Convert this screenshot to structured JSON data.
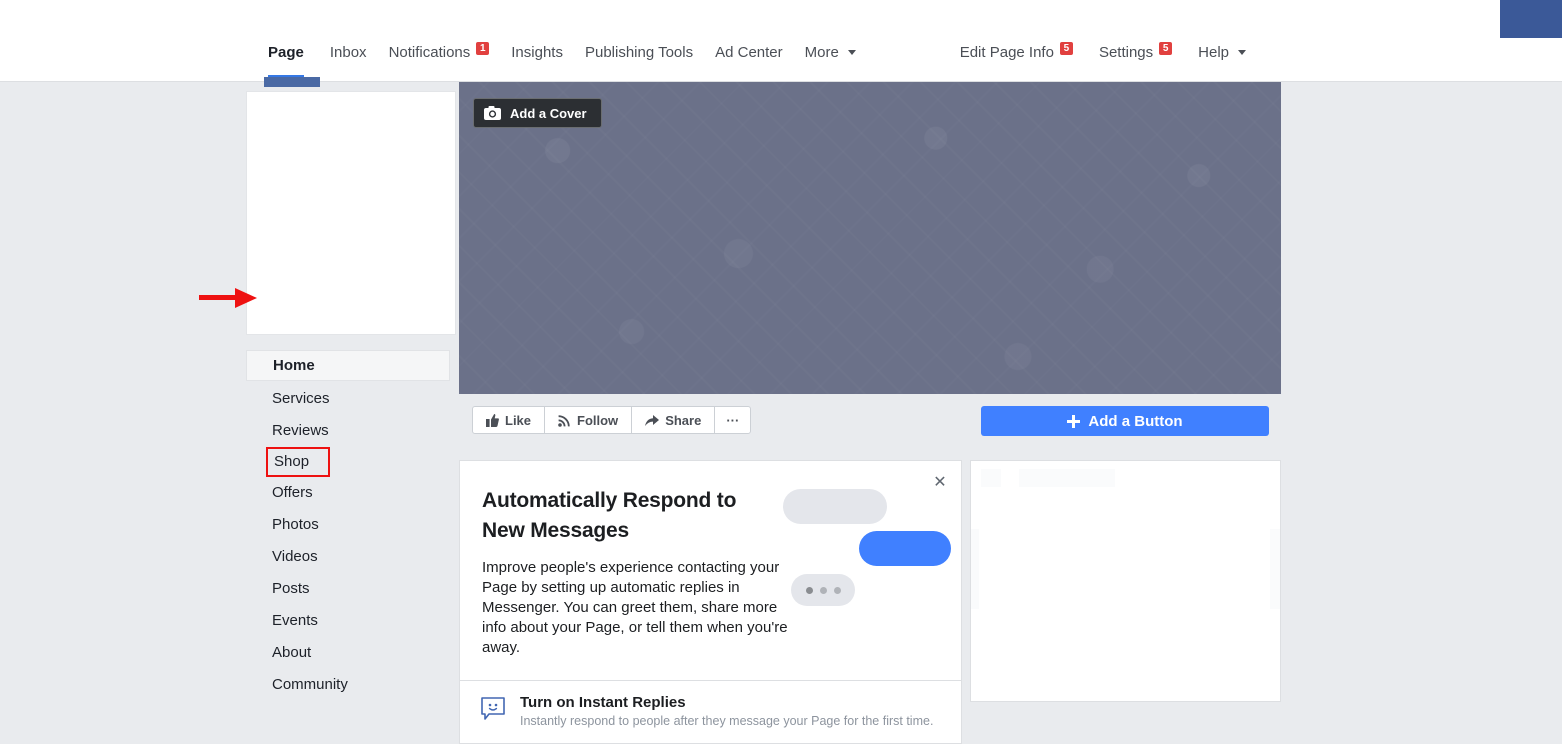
{
  "topbar": {
    "nav_left": [
      {
        "label": "Page",
        "active": true,
        "badge": null,
        "caret": false
      },
      {
        "label": "Inbox",
        "active": false,
        "badge": null,
        "caret": false
      },
      {
        "label": "Notifications",
        "active": false,
        "badge": "1",
        "caret": false
      },
      {
        "label": "Insights",
        "active": false,
        "badge": null,
        "caret": false
      },
      {
        "label": "Publishing Tools",
        "active": false,
        "badge": null,
        "caret": false
      },
      {
        "label": "Ad Center",
        "active": false,
        "badge": null,
        "caret": false
      },
      {
        "label": "More",
        "active": false,
        "badge": null,
        "caret": true
      }
    ],
    "nav_right": [
      {
        "label": "Edit Page Info",
        "badge": "5",
        "caret": false
      },
      {
        "label": "Settings",
        "badge": "5",
        "caret": false
      },
      {
        "label": "Help",
        "badge": null,
        "caret": true
      }
    ]
  },
  "cover": {
    "add_cover_label": "Add a Cover",
    "camera_icon": "camera-icon",
    "bg_color": "#6b7189"
  },
  "sidebar": {
    "items": [
      {
        "label": "Home",
        "state": "current"
      },
      {
        "label": "Services",
        "state": "normal"
      },
      {
        "label": "Reviews",
        "state": "normal"
      },
      {
        "label": "Shop",
        "state": "marked"
      },
      {
        "label": "Offers",
        "state": "normal"
      },
      {
        "label": "Photos",
        "state": "normal"
      },
      {
        "label": "Videos",
        "state": "normal"
      },
      {
        "label": "Posts",
        "state": "normal"
      },
      {
        "label": "Events",
        "state": "normal"
      },
      {
        "label": "About",
        "state": "normal"
      },
      {
        "label": "Community",
        "state": "normal"
      }
    ]
  },
  "annotation": {
    "arrow_color": "#ee1111",
    "highlight_color": "#ee1111",
    "points_to": "Shop"
  },
  "action_bar": {
    "buttons": [
      {
        "label": "Like",
        "icon": "thumbs-up-icon"
      },
      {
        "label": "Follow",
        "icon": "rss-icon"
      },
      {
        "label": "Share",
        "icon": "share-arrow-icon"
      },
      {
        "label": "···",
        "icon": "ellipsis-icon"
      }
    ],
    "add_button": {
      "label": "Add a Button",
      "icon": "plus-icon",
      "color": "#4080ff"
    }
  },
  "promo_card": {
    "title": "Automatically Respond to New Messages",
    "body": "Improve people's experience contacting your Page by setting up automatic replies in Messenger. You can greet them, share more info about your Page, or tell them when you're away.",
    "close_icon": "close-icon",
    "footer": {
      "icon": "chat-smiley-icon",
      "title": "Turn on Instant Replies",
      "subtitle": "Instantly respond to people after they message your Page for the first time."
    }
  },
  "colors": {
    "page_background": "#e9ebee",
    "brand_blue": "#3b5998",
    "accent_blue": "#4080ff",
    "tab_underline": "#3578e5",
    "badge_red": "#e1403f"
  }
}
